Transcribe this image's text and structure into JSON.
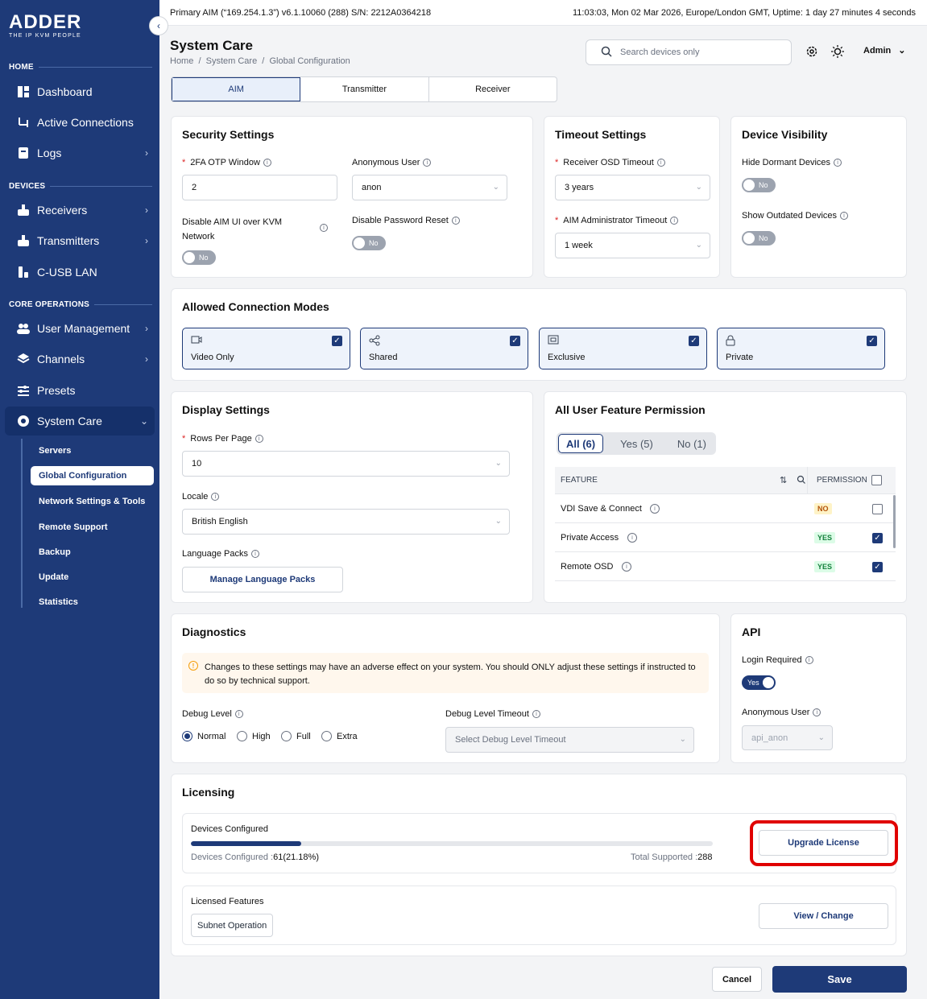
{
  "brand": {
    "name": "ADDER",
    "tagline": "THE IP KVM PEOPLE"
  },
  "topbar": {
    "left": "Primary AIM (“169.254.1.3”) v6.1.10060 (288) S/N: 2212A0364218",
    "right": "11:03:03, Mon 02 Mar 2026, Europe/London GMT, Uptime: 1 day 27 minutes 4 seconds"
  },
  "sidebar": {
    "sections": [
      "HOME",
      "DEVICES",
      "CORE OPERATIONS"
    ],
    "items": [
      {
        "label": "Dashboard",
        "icon": "dashboard-icon"
      },
      {
        "label": "Active Connections",
        "icon": "connections-icon"
      },
      {
        "label": "Logs",
        "icon": "logs-icon"
      },
      {
        "label": "Receivers",
        "icon": "receiver-icon"
      },
      {
        "label": "Transmitters",
        "icon": "transmitter-icon"
      },
      {
        "label": "C-USB LAN",
        "icon": "usb-icon"
      },
      {
        "label": "User Management",
        "icon": "users-icon"
      },
      {
        "label": "Channels",
        "icon": "channels-icon"
      },
      {
        "label": "Presets",
        "icon": "presets-icon"
      },
      {
        "label": "System Care",
        "icon": "system-care-icon"
      }
    ],
    "sub_items": [
      "Servers",
      "Global Configuration",
      "Network Settings & Tools",
      "Remote Support",
      "Backup",
      "Update",
      "Statistics"
    ]
  },
  "header": {
    "title": "System Care",
    "breadcrumb": "Home  /  System Care  /  Global Configuration",
    "search_placeholder": "Search devices only",
    "user": "Admin"
  },
  "tabs": [
    "AIM",
    "Transmitter",
    "Receiver"
  ],
  "security": {
    "title": "Security Settings",
    "otp_label": "2FA OTP Window",
    "otp_value": "2",
    "anon_label": "Anonymous User",
    "anon_value": "anon",
    "disable_ui_label": "Disable AIM UI over KVM",
    "disable_ui_label2": "Network",
    "disable_ui_value": "No",
    "disable_pw_label": "Disable Password Reset",
    "disable_pw_value": "No"
  },
  "timeout": {
    "title": "Timeout Settings",
    "osd_label": "Receiver OSD Timeout",
    "osd_value": "3 years",
    "admin_label": "AIM Administrator Timeout",
    "admin_value": "1 week"
  },
  "visibility": {
    "title": "Device Visibility",
    "dormant_label": "Hide Dormant Devices",
    "dormant_value": "No",
    "outdated_label": "Show Outdated Devices",
    "outdated_value": "No"
  },
  "modes": {
    "title": "Allowed Connection Modes",
    "items": [
      {
        "label": "Video Only",
        "icon": "video-icon"
      },
      {
        "label": "Shared",
        "icon": "share-icon"
      },
      {
        "label": "Exclusive",
        "icon": "exclusive-icon"
      },
      {
        "label": "Private",
        "icon": "lock-icon"
      }
    ]
  },
  "display": {
    "title": "Display Settings",
    "rows_label": "Rows Per Page",
    "rows_value": "10",
    "locale_label": "Locale",
    "locale_value": "British English",
    "lang_label": "Language Packs",
    "lang_button": "Manage Language Packs"
  },
  "permissions": {
    "title": "All User Feature Permission",
    "filters": [
      "All (6)",
      "Yes (5)",
      "No (1)"
    ],
    "col_feature": "FEATURE",
    "col_permission": "PERMISSION",
    "rows": [
      {
        "feature": "VDI Save & Connect",
        "permission": "NO",
        "checked": false
      },
      {
        "feature": "Private Access",
        "permission": "YES",
        "checked": true
      },
      {
        "feature": "Remote OSD",
        "permission": "YES",
        "checked": true
      }
    ]
  },
  "diagnostics": {
    "title": "Diagnostics",
    "warning": "Changes to these settings may have an adverse effect on your system. You should ONLY adjust these settings if instructed to do so by technical support.",
    "debug_label": "Debug Level",
    "levels": [
      "Normal",
      "High",
      "Full",
      "Extra"
    ],
    "selected_level": "Normal",
    "timeout_label": "Debug Level Timeout",
    "timeout_placeholder": "Select Debug Level Timeout"
  },
  "api": {
    "title": "API",
    "login_label": "Login Required",
    "login_value": "Yes",
    "anon_label": "Anonymous User",
    "anon_value": "api_anon"
  },
  "licensing": {
    "title": "Licensing",
    "devices_label": "Devices Configured",
    "devices_text": "Devices Configured :",
    "devices_value": "61(21.18%)",
    "progress": 0.2118,
    "total_text": "Total Supported :",
    "total_value": "288",
    "upgrade_button": "Upgrade License",
    "features_label": "Licensed Features",
    "feature_tag": "Subnet Operation",
    "change_button": "View / Change"
  },
  "footer": {
    "cancel": "Cancel",
    "save": "Save"
  },
  "colors": {
    "primary": "#1e3a78",
    "highlight": "#e00000"
  }
}
